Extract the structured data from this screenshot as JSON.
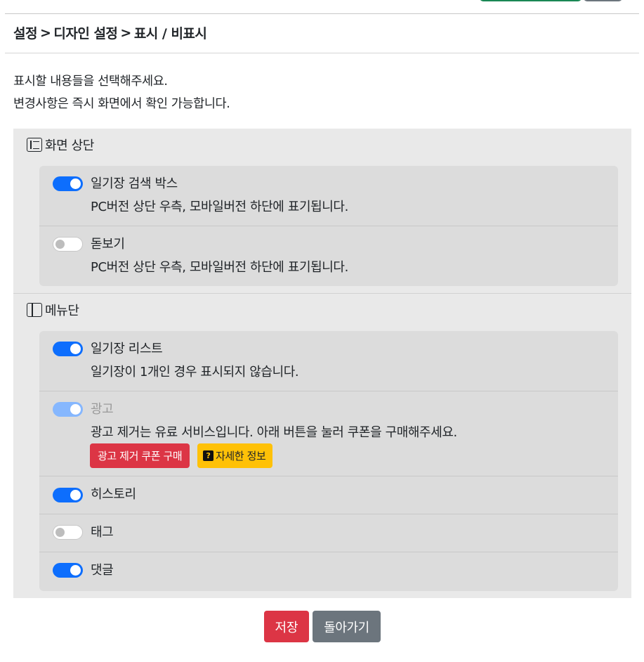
{
  "breadcrumb": [
    "설정",
    "디자인 설정",
    "표시 / 비표시"
  ],
  "breadcrumb_separator": ">",
  "intro": {
    "line1": "표시할 내용들을 선택해주세요.",
    "line2": "변경사항은 즉시 화면에서 확인 가능합니다."
  },
  "sections": [
    {
      "title": "화면 상단",
      "icon": "layout-top-icon",
      "items": [
        {
          "title": "일기장 검색 박스",
          "desc": "PC버전 상단 우측, 모바일버전 하단에 표기됩니다.",
          "enabled": true
        },
        {
          "title": "돋보기",
          "desc": "PC버전 상단 우측, 모바일버전 하단에 표기됩니다.",
          "enabled": false
        }
      ]
    },
    {
      "title": "메뉴단",
      "icon": "layout-sidebar-icon",
      "items": [
        {
          "title": "일기장 리스트",
          "desc": "일기장이 1개인 경우 표시되지 않습니다.",
          "enabled": true
        },
        {
          "title": "광고",
          "desc": "광고 제거는 유료 서비스입니다. 아래 버튼을 눌러 쿠폰을 구매해주세요.",
          "enabled": true,
          "disabled": true,
          "buttons": {
            "buy": "광고 제거 쿠폰 구매",
            "info_icon": "?",
            "info": "자세한 정보"
          }
        },
        {
          "title": "히스토리",
          "enabled": true
        },
        {
          "title": "태그",
          "enabled": false
        },
        {
          "title": "댓글",
          "enabled": true
        }
      ]
    }
  ],
  "footer": {
    "save": "저장",
    "back": "돌아가기"
  },
  "colors": {
    "primary": "#0d6efd",
    "danger": "#dc3545",
    "warning": "#ffc107",
    "secondary": "#6c757d"
  }
}
